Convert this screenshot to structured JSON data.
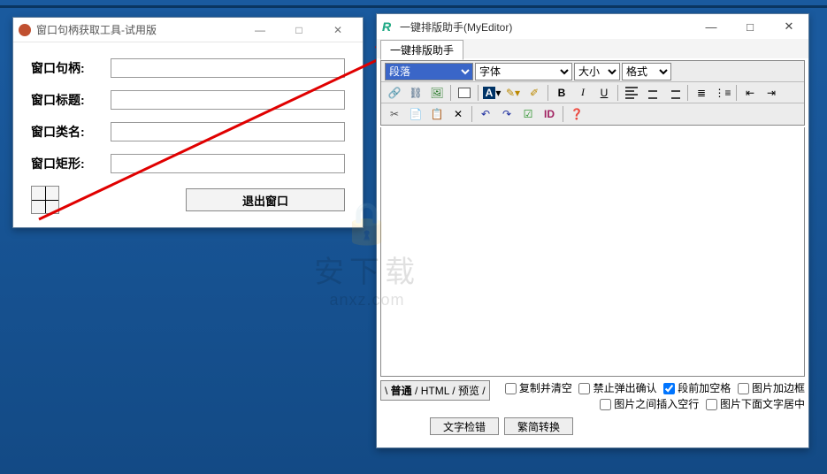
{
  "win1": {
    "title": "窗口句柄获取工具-试用版",
    "labels": {
      "handle": "窗口句柄:",
      "caption": "窗口标题:",
      "class": "窗口类名:",
      "rect": "窗口矩形:"
    },
    "exit": "退出窗口"
  },
  "win2": {
    "title": "一键排版助手(MyEditor)",
    "tab": "一键排版助手",
    "selects": {
      "para": "段落",
      "font": "字体",
      "size": "大小",
      "format": "格式"
    },
    "view_tabs": {
      "normal": "普通",
      "html": "HTML",
      "preview": "预览"
    },
    "checks": {
      "c1": "复制并清空",
      "c2": "禁止弹出确认",
      "c3": "段前加空格",
      "c4": "图片加边框",
      "c5": "图片之间插入空行",
      "c6": "图片下面文字居中"
    },
    "checked": {
      "c3": true
    },
    "buttons": {
      "b1": "文字检错",
      "b2": "繁简转换"
    }
  },
  "watermark": {
    "cn": "安下载",
    "en": "anxz.com"
  }
}
